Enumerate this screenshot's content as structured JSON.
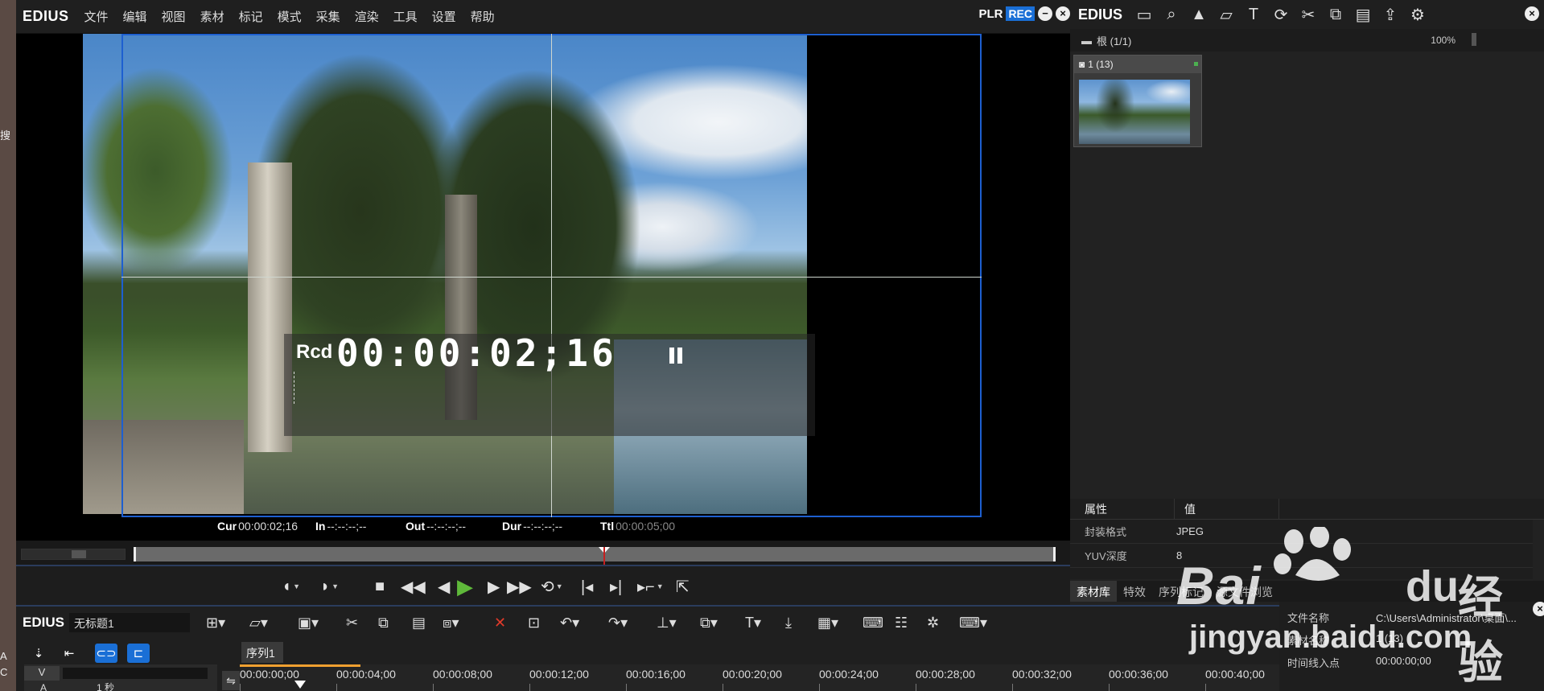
{
  "left_strip": {
    "char1": "搜",
    "char2": "A",
    "char3": "C"
  },
  "player": {
    "logo": "EDIUS",
    "menu": [
      "文件",
      "编辑",
      "视图",
      "素材",
      "标记",
      "模式",
      "采集",
      "渲染",
      "工具",
      "设置",
      "帮助"
    ],
    "plr": "PLR",
    "rec": "REC",
    "timecode_label": "Rcd",
    "timecode": "00:00:02;16",
    "info": {
      "cur_label": "Cur",
      "cur_value": "00:00:02;16",
      "in_label": "In",
      "in_value": "--:--:--;--",
      "out_label": "Out",
      "out_value": "--:--:--;--",
      "dur_label": "Dur",
      "dur_value": "--:--:--;--",
      "ttl_label": "Ttl",
      "ttl_value": "00:00:05;00"
    },
    "playhead_fraction": 0.51,
    "accent": "#1a6fd6",
    "play_color": "#5fb93a"
  },
  "bin": {
    "logo": "EDIUS",
    "path": "根 (1/1)",
    "zoom": "100%",
    "clip_title": "1 (13)",
    "properties": {
      "col_attr": "属性",
      "col_value": "值",
      "rows": [
        {
          "key": "封装格式",
          "value": "JPEG"
        },
        {
          "key": "YUV深度",
          "value": "8"
        }
      ]
    },
    "tabs": [
      "素材库",
      "特效",
      "序列标记",
      "源文件浏览"
    ],
    "info": [
      {
        "key": "文件名称",
        "value": "C:\\Users\\Administrator\\桌面\\..."
      },
      {
        "key": "素材名称",
        "value": "1 (13)"
      },
      {
        "key": "时间线入点",
        "value": "00:00:00;00"
      }
    ]
  },
  "timeline": {
    "logo": "EDIUS",
    "project": "无标题1",
    "sequence_tab": "序列1",
    "track_v": "V",
    "track_a": "A",
    "scale": "1 秒",
    "ruler": [
      "00:00:00;00",
      "00:00:04;00",
      "00:00:08;00",
      "00:00:12;00",
      "00:00:16;00",
      "00:00:20;00",
      "00:00:24;00",
      "00:00:28;00",
      "00:00:32;00",
      "00:00:36;00",
      "00:00:40;00"
    ]
  },
  "watermark": {
    "bai": "Bai",
    "du": "du",
    "jingyan": "经验",
    "url": "jingyan.baidu.com"
  }
}
